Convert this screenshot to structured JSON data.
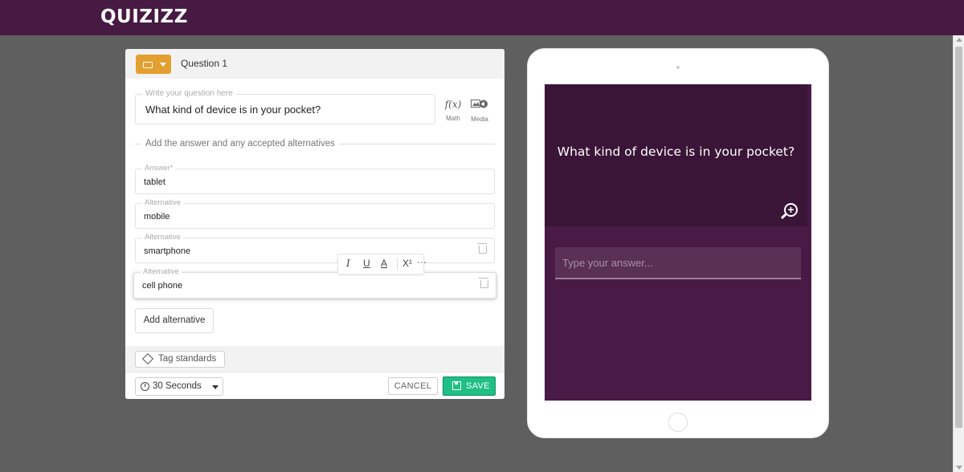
{
  "app": {
    "brand": "QUIZIZZ",
    "colors": {
      "topbar": "#461a42",
      "accent": "#e3a030",
      "save": "#1fbf86",
      "screen": "#4a1a47"
    }
  },
  "editor": {
    "question_label": "Question 1",
    "question_placeholder": "Write your question here",
    "question_text": "What kind of device is in your pocket?",
    "tools": {
      "math_label": "Math",
      "math_glyph": "f(x)",
      "media_label": "Media"
    },
    "answers_heading": "Add the answer and any accepted alternatives",
    "answer": {
      "label": "Answer*",
      "value": "tablet"
    },
    "alternatives": [
      {
        "label": "Alternative",
        "value": "mobile"
      },
      {
        "label": "Alternative",
        "value": "smartphone"
      },
      {
        "label": "Alternative",
        "value": "cell phone"
      }
    ],
    "format_toolbar": {
      "italic": "I",
      "underline": "U",
      "color": "A",
      "superscript": "X¹",
      "more": "···"
    },
    "add_alternative_label": "Add alternative",
    "tag_standards_label": "Tag standards",
    "time_value": "30 Seconds",
    "cancel_label": "CANCEL",
    "save_label": "SAVE"
  },
  "preview": {
    "question_text": "What kind of device is in your pocket?",
    "answer_placeholder": "Type your answer..."
  }
}
